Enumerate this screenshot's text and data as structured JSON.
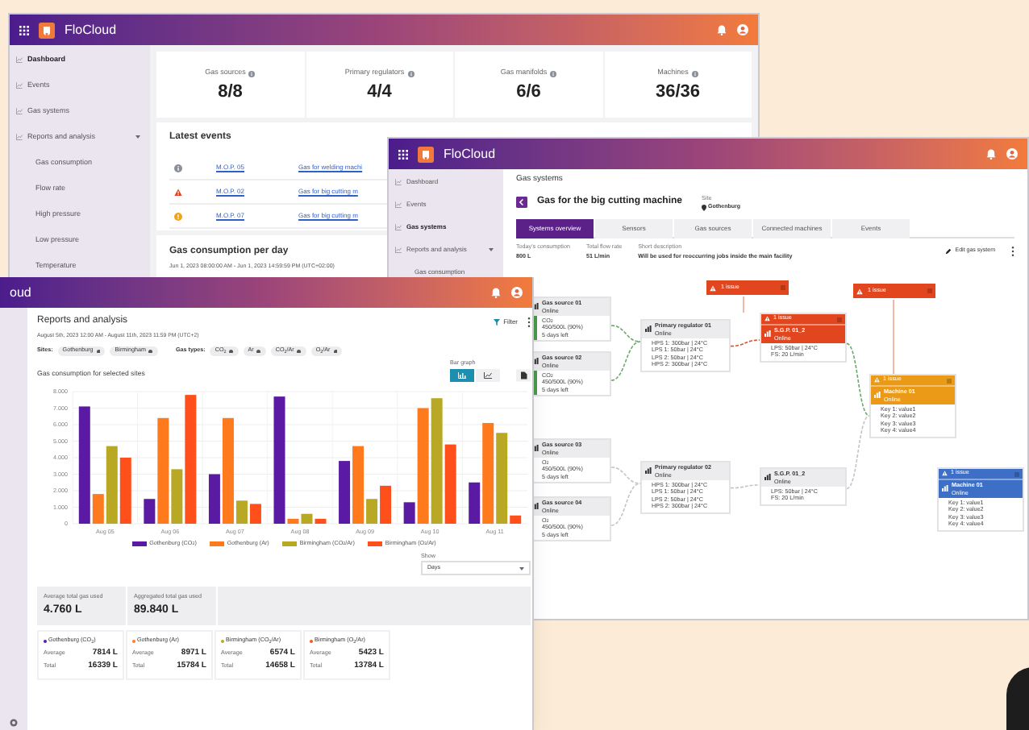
{
  "dashboard_window": {
    "app_name": "FloCloud",
    "sidebar": [
      {
        "label": "Dashboard",
        "selected": true
      },
      {
        "label": "Events",
        "selected": false
      },
      {
        "label": "Gas systems",
        "selected": false
      },
      {
        "label": "Reports and analysis",
        "selected": false,
        "expanded": true,
        "children": [
          {
            "label": "Gas consumption",
            "selected": false
          },
          {
            "label": "Flow rate",
            "selected": false
          },
          {
            "label": "High pressure",
            "selected": false
          },
          {
            "label": "Low pressure",
            "selected": false
          },
          {
            "label": "Temperature",
            "selected": false
          }
        ]
      }
    ],
    "stats": [
      {
        "label": "Gas sources",
        "value": "8/8"
      },
      {
        "label": "Primary regulators",
        "value": "4/4"
      },
      {
        "label": "Gas manifolds",
        "value": "6/6"
      },
      {
        "label": "Machines",
        "value": "36/36"
      }
    ],
    "latest_events": {
      "title": "Latest events",
      "rows": [
        {
          "kind": "info",
          "id": "M.O.P. 05",
          "system": "Gas for welding machi"
        },
        {
          "kind": "alarm",
          "id": "M.O.P. 02",
          "system": "Gas for big cutting m"
        },
        {
          "kind": "warning",
          "id": "M.O.P. 07",
          "system": "Gas for big cutting m"
        }
      ]
    },
    "consumption": {
      "title": "Gas consumption per day",
      "range": "Jun 1, 2023 08:00:00 AM - Jun 1, 2023 14:59:59 PM (UTC+02:00)"
    }
  },
  "gas_system_window": {
    "app_name": "FloCloud",
    "sidebar": [
      {
        "label": "Dashboard",
        "selected": false
      },
      {
        "label": "Events",
        "selected": false
      },
      {
        "label": "Gas systems",
        "selected": true
      },
      {
        "label": "Reports and analysis",
        "selected": false,
        "expanded": true,
        "children": [
          {
            "label": "Gas consumption",
            "selected": false
          }
        ]
      }
    ],
    "page_title": "Gas systems",
    "system_name": "Gas for the big cutting machine",
    "site_label": "Site",
    "site": "Gothenburg",
    "tabs": [
      {
        "label": "Systems overview",
        "selected": true
      },
      {
        "label": "Sensors",
        "selected": false
      },
      {
        "label": "Gas sources",
        "selected": false
      },
      {
        "label": "Connected machines",
        "selected": false
      },
      {
        "label": "Events",
        "selected": false
      }
    ],
    "info": [
      {
        "label": "Today's consumption",
        "value": "800 L"
      },
      {
        "label": "Total flow rate",
        "value": "51 L/min"
      },
      {
        "label": "Short description",
        "value": "Will be used for reoccurring jobs inside the main facility"
      }
    ],
    "edit_label": "Edit gas system",
    "diagram": {
      "nodes": [
        {
          "kind": "source",
          "color": "#ececee",
          "active": true,
          "title": "Gas source 01",
          "status": "Online",
          "lines": [
            "CO$_{2}$",
            "450/500L (90%)",
            "5 days left"
          ]
        },
        {
          "kind": "source",
          "color": "#ececee",
          "active": true,
          "title": "Gas source 02",
          "status": "Online",
          "lines": [
            "CO$_{2}$",
            "450/500L (90%)",
            "5 days left"
          ]
        },
        {
          "kind": "source",
          "color": "#ececee",
          "active": false,
          "title": "Gas source 03",
          "status": "Online",
          "lines": [
            "O$_{2}$",
            "450/500L (90%)",
            "5 days left"
          ]
        },
        {
          "kind": "source",
          "color": "#ececee",
          "active": false,
          "title": "Gas source 04",
          "status": "Online",
          "lines": [
            "O$_{2}$",
            "450/500L (90%)",
            "5 days left"
          ]
        },
        {
          "kind": "regulator",
          "color": "#ececee",
          "title": "Primary regulator 01",
          "status": "Online",
          "lines": [
            "HPS 1: 300bar | 24°C",
            "LPS 1: 50bar | 24°C",
            "LPS 2: 50bar | 24°C",
            "HPS 2: 300bar | 24°C"
          ]
        },
        {
          "kind": "regulator",
          "color": "#ececee",
          "title": "Primary regulator 02",
          "status": "Online",
          "lines": [
            "HPS 1: 300bar | 24°C",
            "LPS 1: 50bar | 24°C",
            "LPS 2: 50bar | 24°C",
            "HPS 2: 300bar | 24°C"
          ]
        },
        {
          "kind": "sgp",
          "color": "#e2461e",
          "issue": "1 issue",
          "title": "S.G.P. 01_2",
          "status": "Online",
          "lines": [
            "LPS: 50bar | 24°C",
            "FS: 20 L/min"
          ]
        },
        {
          "kind": "sgp",
          "color": "#ececee",
          "title": "S.G.P. 01_2",
          "status": "Online",
          "lines": [
            "LPS: 50bar | 24°C",
            "FS: 20 L/min"
          ]
        },
        {
          "kind": "machine",
          "color": "#ea9a16",
          "issue": "1 issue",
          "title": "Machine 01",
          "status": "Online",
          "lines": [
            "Key 1: value1",
            "Key 2: value2",
            "Key 3: value3",
            "Key 4: value4"
          ]
        },
        {
          "kind": "machine",
          "color": "#3d6fc6",
          "issue": "1 issue",
          "title": "Machine 01",
          "status": "Online",
          "lines": [
            "Key 1: value1",
            "Key 2: value2",
            "Key 3: value3",
            "Key 4: value4"
          ]
        }
      ],
      "issue_flags": [
        {
          "label": "1 issue"
        },
        {
          "label": "1 issue"
        }
      ]
    }
  },
  "reports_window": {
    "app_name": "oud",
    "title": "Reports and analysis",
    "range": "August 5th, 2023 12:00 AM - August 11th, 2023 11:59 PM (UTC+2)",
    "filter_label": "Filter",
    "sites_label": "Sites:",
    "sites": [
      "Gothenburg",
      "Birmingham"
    ],
    "gas_types_label": "Gas types:",
    "gas_types": [
      "CO$_{2}$",
      "Ar",
      "CO$_{2}$/Ar",
      "O$_{2}$/Ar"
    ],
    "chart_title": "Gas consumption for selected sites",
    "view_label": "Bar graph",
    "views": [
      {
        "kind": "bar",
        "selected": true
      },
      {
        "kind": "line",
        "selected": false
      }
    ],
    "chart_data": {
      "type": "bar",
      "grid": true,
      "categories": [
        "Aug 05",
        "Aug 06",
        "Aug 07",
        "Aug 08",
        "Aug 09",
        "Aug 10",
        "Aug 11"
      ],
      "ylim": [
        0,
        8000
      ],
      "yticks": [
        {
          "value": 0,
          "label": "0"
        },
        {
          "value": 1000,
          "label": "1.000"
        },
        {
          "value": 2000,
          "label": "2.000"
        },
        {
          "value": 3000,
          "label": "3.000"
        },
        {
          "value": 4000,
          "label": "4.000"
        },
        {
          "value": 5000,
          "label": "5.000"
        },
        {
          "value": 6000,
          "label": "6.000"
        },
        {
          "value": 7000,
          "label": "7.000"
        },
        {
          "value": 8000,
          "label": "8.000"
        }
      ],
      "series": [
        {
          "name": "Gothenburg (CO$_{2}$)",
          "color": "#5a1aa3",
          "values": [
            7100,
            1500,
            3000,
            7700,
            3800,
            1300,
            2500
          ]
        },
        {
          "name": "Gothenburg (Ar)",
          "color": "#ff7a1c",
          "values": [
            1800,
            6400,
            6400,
            300,
            4700,
            7000,
            6100
          ]
        },
        {
          "name": "Birmingham (CO$_{2}$/Ar)",
          "color": "#b8a824",
          "values": [
            4700,
            3300,
            1400,
            600,
            1500,
            7600,
            5500
          ]
        },
        {
          "name": "Birmingham (O$_{2}$/Ar)",
          "color": "#ff501c",
          "values": [
            4000,
            7800,
            1200,
            300,
            2300,
            4800,
            500
          ]
        }
      ]
    },
    "show_label": "Show",
    "show_value": "Days",
    "summary": [
      {
        "label": "Average total gas used",
        "value": "4.760 L"
      },
      {
        "label": "Aggregated total gas used",
        "value": "89.840 L"
      }
    ],
    "cards": [
      {
        "name": "Gothenburg (CO$_{2}$)",
        "color": "#5a1aa3",
        "average_label": "Average",
        "average": "7814 L",
        "total_label": "Total",
        "total": "16339 L"
      },
      {
        "name": "Gothenburg (Ar)",
        "color": "#ff7a1c",
        "average_label": "Average",
        "average": "8971 L",
        "total_label": "Total",
        "total": "15784 L"
      },
      {
        "name": "Birmingham (CO$_{2}$/Ar)",
        "color": "#b8a824",
        "average_label": "Average",
        "average": "6574 L",
        "total_label": "Total",
        "total": "14658 L"
      },
      {
        "name": "Birmingham (O$_{2}$/Ar)",
        "color": "#ff501c",
        "average_label": "Average",
        "average": "5423 L",
        "total_label": "Total",
        "total": "13784 L"
      }
    ]
  }
}
